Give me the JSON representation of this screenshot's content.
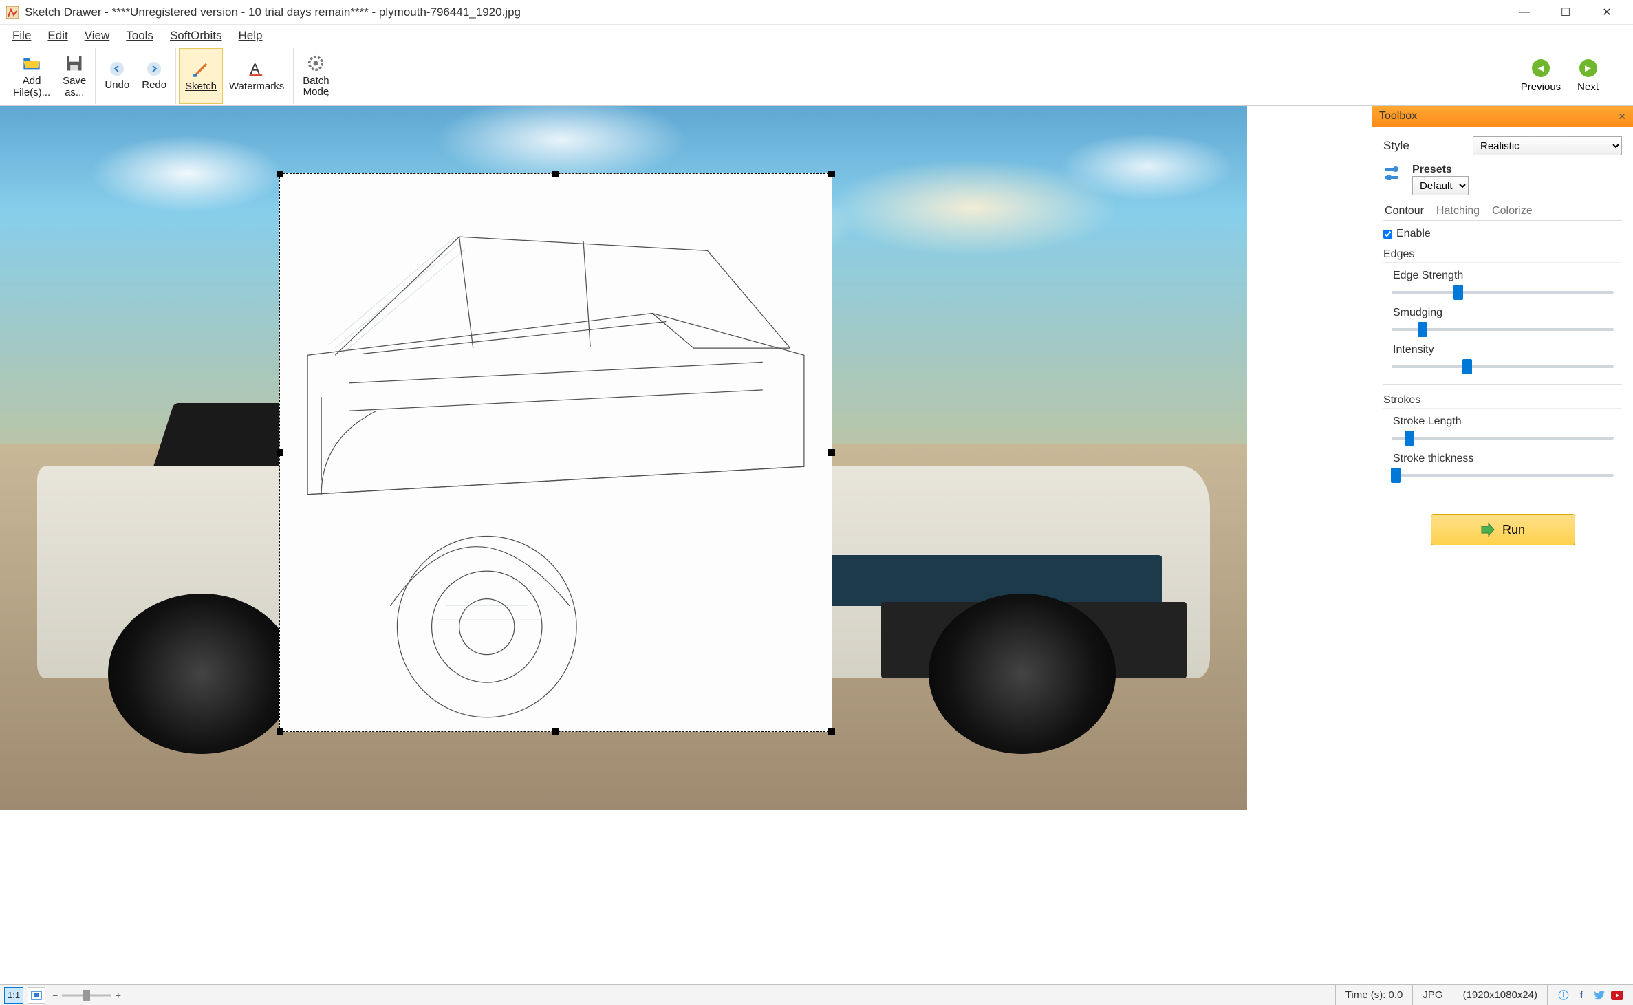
{
  "titlebar": {
    "app_name": "Sketch Drawer",
    "title": " - ****Unregistered version - 10 trial days remain**** - plymouth-796441_1920.jpg"
  },
  "menubar": {
    "items": [
      "File",
      "Edit",
      "View",
      "Tools",
      "SoftOrbits",
      "Help"
    ]
  },
  "toolbar": {
    "add_files": "Add\nFile(s)...",
    "save_as": "Save\nas...",
    "undo": "Undo",
    "redo": "Redo",
    "sketch": "Sketch",
    "watermarks": "Watermarks",
    "batch_mode": "Batch\nMode",
    "previous": "Previous",
    "next": "Next"
  },
  "toolbox": {
    "title": "Toolbox",
    "style_label": "Style",
    "style_value": "Realistic",
    "presets_label": "Presets",
    "presets_value": "Default",
    "tabs": {
      "contour": "Contour",
      "hatching": "Hatching",
      "colorize": "Colorize"
    },
    "enable_label": "Enable",
    "edges_label": "Edges",
    "sliders": {
      "edge_strength": {
        "label": "Edge Strength",
        "pos": 30
      },
      "smudging": {
        "label": "Smudging",
        "pos": 14
      },
      "intensity": {
        "label": "Intensity",
        "pos": 34
      }
    },
    "strokes_label": "Strokes",
    "stroke_sliders": {
      "stroke_length": {
        "label": "Stroke Length",
        "pos": 8
      },
      "stroke_thickness": {
        "label": "Stroke thickness",
        "pos": 2
      }
    },
    "run": "Run"
  },
  "statusbar": {
    "zoom_label": "1:1",
    "time": "Time (s): 0.0",
    "format": "JPG",
    "dimensions": "(1920x1080x24)"
  }
}
